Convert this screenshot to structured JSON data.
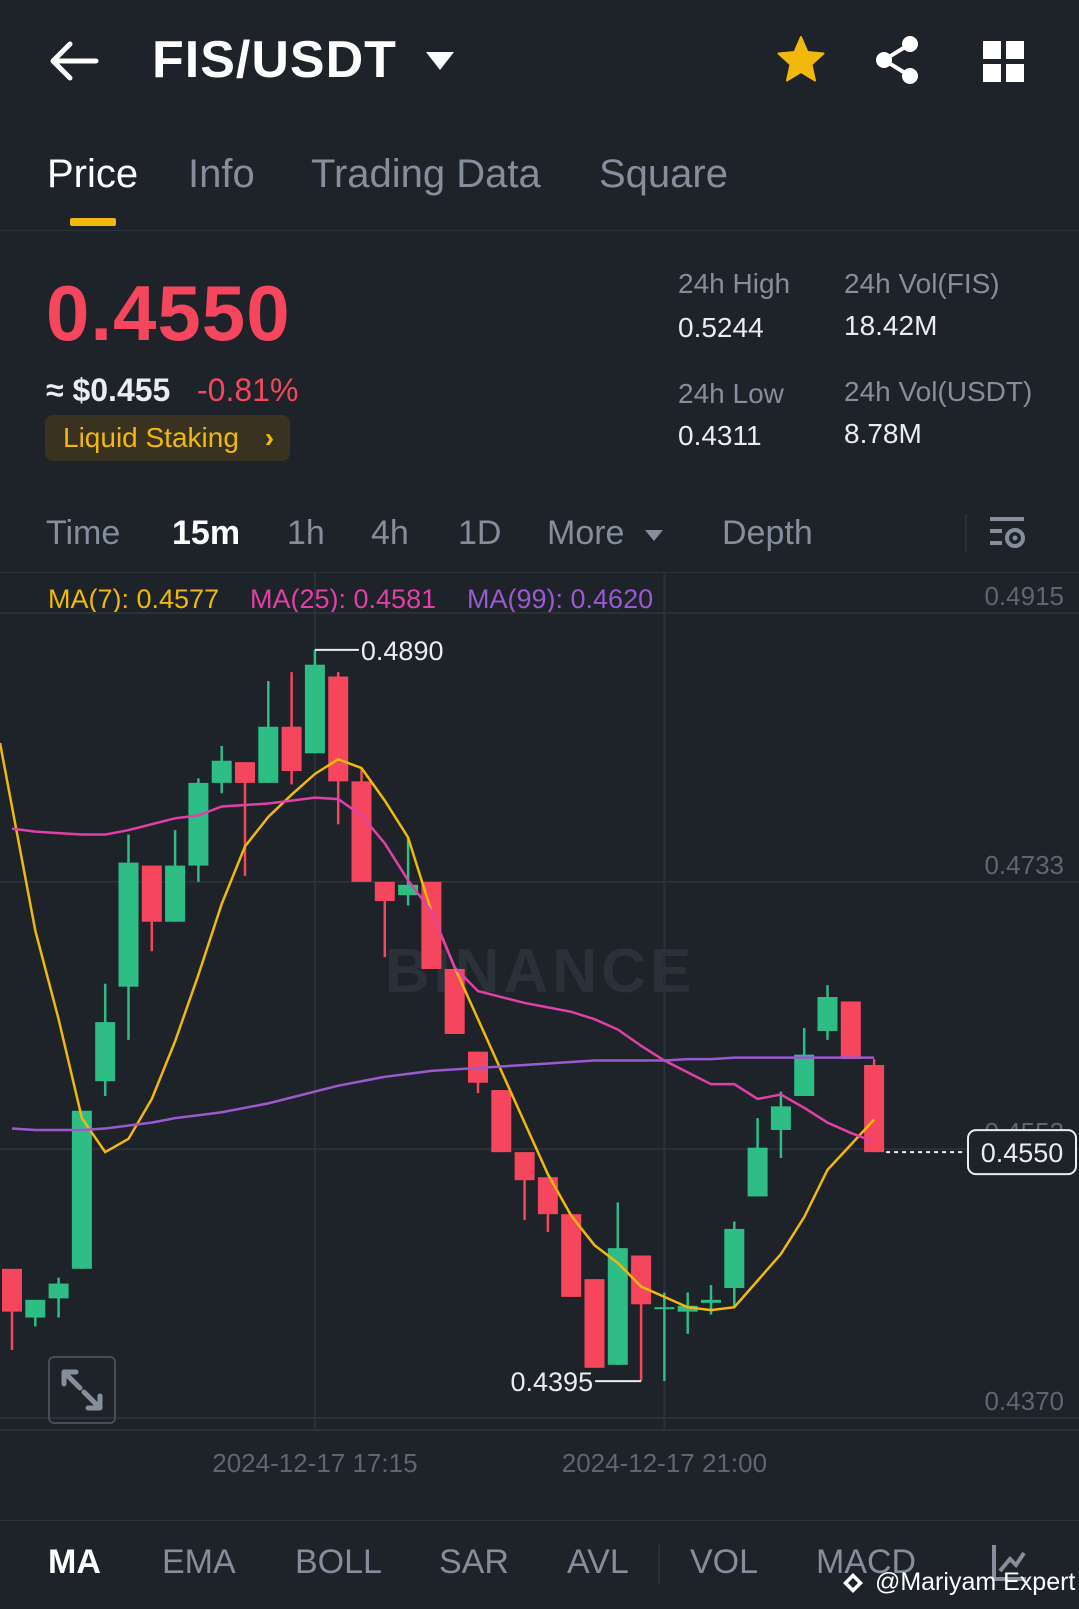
{
  "header": {
    "pair": "FIS/USDT"
  },
  "tabs": [
    {
      "label": "Price"
    },
    {
      "label": "Info"
    },
    {
      "label": "Trading Data"
    },
    {
      "label": "Square"
    }
  ],
  "price": {
    "last": "0.4550",
    "approx": "≈ $0.455",
    "change": "-0.81%",
    "tag": "Liquid Staking",
    "tag_arrow": "›"
  },
  "stats": {
    "high_label": "24h High",
    "high_value": "0.5244",
    "low_label": "24h Low",
    "low_value": "0.4311",
    "vol_fis_label": "24h Vol(FIS)",
    "vol_fis_value": "18.42M",
    "vol_usdt_label": "24h Vol(USDT)",
    "vol_usdt_value": "8.78M"
  },
  "intervals": {
    "time": "Time",
    "m15": "15m",
    "h1": "1h",
    "h4": "4h",
    "d1": "1D",
    "more": "More",
    "depth": "Depth"
  },
  "ma_legend": {
    "ma7": "MA(7): 0.4577",
    "ma25": "MA(25): 0.4581",
    "ma99": "MA(99): 0.4620"
  },
  "colors": {
    "up": "#2ebd85",
    "down": "#f6465d",
    "accent": "#f0b90b",
    "ma7": "#f0b90b",
    "ma25": "#e040a8",
    "ma99": "#9b59d0"
  },
  "indicators": [
    "MA",
    "EMA",
    "BOLL",
    "SAR",
    "AVL",
    "VOL",
    "MACD"
  ],
  "credit": "@Mariyam Expert",
  "chart_data": {
    "type": "candlestick",
    "interval": "15m",
    "y_ticks": [
      "0.4915",
      "0.4733",
      "0.4552",
      "0.4370"
    ],
    "ylim": [
      0.437,
      0.4915
    ],
    "x_ticks": [
      "2024-12-17 17:15",
      "2024-12-17 21:00"
    ],
    "x_tick_index": [
      13,
      28
    ],
    "current_price": "0.4550",
    "max_label": "0.4890",
    "min_label": "0.4395",
    "watermark": "BINANCE",
    "candles": [
      {
        "o": 0.4471,
        "c": 0.4442,
        "h": 0.4468,
        "l": 0.4416
      },
      {
        "o": 0.4438,
        "c": 0.445,
        "h": 0.445,
        "l": 0.4432
      },
      {
        "o": 0.4451,
        "c": 0.4461,
        "h": 0.4465,
        "l": 0.4438
      },
      {
        "o": 0.4471,
        "c": 0.4578,
        "h": 0.4578,
        "l": 0.4471
      },
      {
        "o": 0.4598,
        "c": 0.4638,
        "h": 0.4664,
        "l": 0.4588
      },
      {
        "o": 0.4662,
        "c": 0.4746,
        "h": 0.4765,
        "l": 0.4626
      },
      {
        "o": 0.4744,
        "c": 0.4706,
        "h": 0.4744,
        "l": 0.4686
      },
      {
        "o": 0.4706,
        "c": 0.4744,
        "h": 0.4768,
        "l": 0.4706
      },
      {
        "o": 0.4744,
        "c": 0.48,
        "h": 0.4803,
        "l": 0.4733
      },
      {
        "o": 0.48,
        "c": 0.4815,
        "h": 0.4825,
        "l": 0.4793
      },
      {
        "o": 0.4814,
        "c": 0.48,
        "h": 0.4814,
        "l": 0.4737
      },
      {
        "o": 0.48,
        "c": 0.4838,
        "h": 0.4869,
        "l": 0.48
      },
      {
        "o": 0.4838,
        "c": 0.4808,
        "h": 0.4875,
        "l": 0.4799
      },
      {
        "o": 0.482,
        "c": 0.488,
        "h": 0.489,
        "l": 0.482
      },
      {
        "o": 0.4872,
        "c": 0.4801,
        "h": 0.4875,
        "l": 0.4772
      },
      {
        "o": 0.4801,
        "c": 0.4733,
        "h": 0.4809,
        "l": 0.4733
      },
      {
        "o": 0.4733,
        "c": 0.472,
        "h": 0.4733,
        "l": 0.4682
      },
      {
        "o": 0.4724,
        "c": 0.4731,
        "h": 0.4763,
        "l": 0.4717
      },
      {
        "o": 0.4733,
        "c": 0.4674,
        "h": 0.4733,
        "l": 0.4674
      },
      {
        "o": 0.4674,
        "c": 0.463,
        "h": 0.4674,
        "l": 0.463
      },
      {
        "o": 0.4618,
        "c": 0.4597,
        "h": 0.4618,
        "l": 0.459
      },
      {
        "o": 0.4592,
        "c": 0.455,
        "h": 0.4592,
        "l": 0.455
      },
      {
        "o": 0.455,
        "c": 0.4531,
        "h": 0.455,
        "l": 0.4504
      },
      {
        "o": 0.4533,
        "c": 0.4508,
        "h": 0.4533,
        "l": 0.4496
      },
      {
        "o": 0.4508,
        "c": 0.4452,
        "h": 0.4508,
        "l": 0.4452
      },
      {
        "o": 0.4464,
        "c": 0.4404,
        "h": 0.4464,
        "l": 0.4404
      },
      {
        "o": 0.4406,
        "c": 0.4485,
        "h": 0.4516,
        "l": 0.4406
      },
      {
        "o": 0.448,
        "c": 0.4447,
        "h": 0.448,
        "l": 0.4395
      },
      {
        "o": 0.4445,
        "c": 0.4445,
        "h": 0.4455,
        "l": 0.4395
      },
      {
        "o": 0.4442,
        "c": 0.4446,
        "h": 0.4455,
        "l": 0.4427
      },
      {
        "o": 0.4448,
        "c": 0.445,
        "h": 0.446,
        "l": 0.444
      },
      {
        "o": 0.4458,
        "c": 0.4498,
        "h": 0.4503,
        "l": 0.4445
      },
      {
        "o": 0.452,
        "c": 0.4553,
        "h": 0.4573,
        "l": 0.452
      },
      {
        "o": 0.4565,
        "c": 0.4581,
        "h": 0.4591,
        "l": 0.4546
      },
      {
        "o": 0.4588,
        "c": 0.4616,
        "h": 0.4634,
        "l": 0.4588
      },
      {
        "o": 0.4632,
        "c": 0.4655,
        "h": 0.4663,
        "l": 0.4626
      },
      {
        "o": 0.4652,
        "c": 0.4613,
        "h": 0.4652,
        "l": 0.4613
      },
      {
        "o": 0.4609,
        "c": 0.455,
        "h": 0.4613,
        "l": 0.455
      }
    ],
    "series": [
      {
        "name": "MA(7)",
        "values": [
          0.4827,
          0.47,
          0.464,
          0.4573,
          0.455,
          0.4559,
          0.4586,
          0.4625,
          0.467,
          0.4718,
          0.4757,
          0.4777,
          0.4792,
          0.4806,
          0.4816,
          0.481,
          0.4788,
          0.4763,
          0.4713,
          0.4675,
          0.464,
          0.4605,
          0.457,
          0.4535,
          0.4507,
          0.4487,
          0.4475,
          0.4459,
          0.4452,
          0.4445,
          0.4443,
          0.4445,
          0.4463,
          0.4481,
          0.4506,
          0.4538,
          0.4555,
          0.4572
        ]
      },
      {
        "name": "MA(25)",
        "values": [
          0.4769,
          0.4767,
          0.4766,
          0.4765,
          0.4765,
          0.4768,
          0.4772,
          0.4776,
          0.4778,
          0.4784,
          0.4785,
          0.4786,
          0.4788,
          0.479,
          0.4789,
          0.4778,
          0.4759,
          0.4734,
          0.4713,
          0.4675,
          0.4659,
          0.4655,
          0.4651,
          0.4648,
          0.4645,
          0.464,
          0.4633,
          0.4622,
          0.4612,
          0.4604,
          0.4596,
          0.4596,
          0.4586,
          0.4589,
          0.458,
          0.457,
          0.4563,
          0.4557
        ]
      },
      {
        "name": "MA(99)",
        "values": [
          0.4566,
          0.4565,
          0.4565,
          0.4565,
          0.4566,
          0.4568,
          0.457,
          0.4573,
          0.4575,
          0.4577,
          0.458,
          0.4583,
          0.4587,
          0.4591,
          0.4595,
          0.4598,
          0.4601,
          0.4603,
          0.4605,
          0.4606,
          0.4607,
          0.4608,
          0.4609,
          0.461,
          0.4611,
          0.4612,
          0.4612,
          0.4612,
          0.4612,
          0.4613,
          0.4613,
          0.4614,
          0.4614,
          0.4614,
          0.4614,
          0.4614,
          0.4614,
          0.4614
        ]
      }
    ]
  }
}
